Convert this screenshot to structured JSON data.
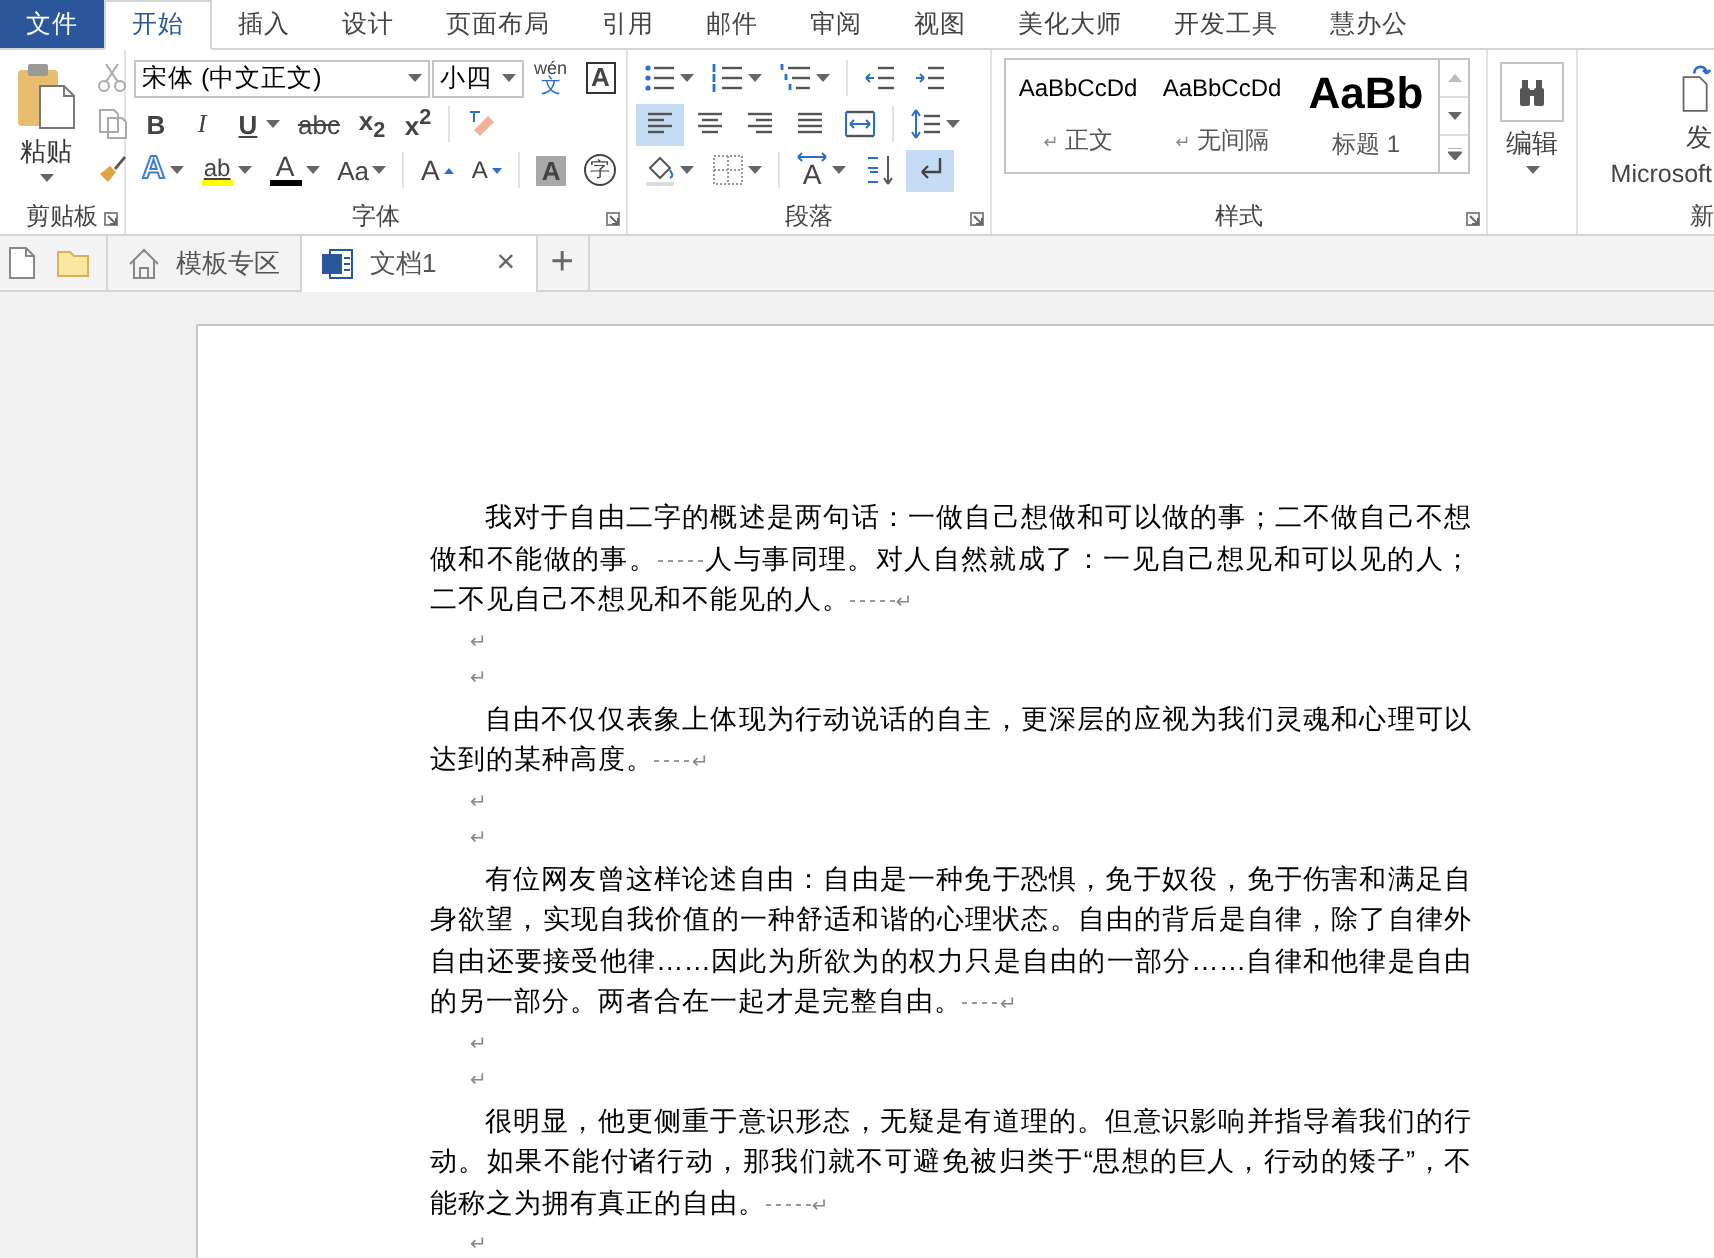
{
  "ribbon_tabs": [
    {
      "label": "文件",
      "kind": "file",
      "selected": false
    },
    {
      "label": "开始",
      "kind": "normal",
      "selected": true
    },
    {
      "label": "插入",
      "kind": "normal",
      "selected": false
    },
    {
      "label": "设计",
      "kind": "normal",
      "selected": false
    },
    {
      "label": "页面布局",
      "kind": "normal",
      "selected": false
    },
    {
      "label": "引用",
      "kind": "normal",
      "selected": false
    },
    {
      "label": "邮件",
      "kind": "normal",
      "selected": false
    },
    {
      "label": "审阅",
      "kind": "normal",
      "selected": false
    },
    {
      "label": "视图",
      "kind": "normal",
      "selected": false
    },
    {
      "label": "美化大师",
      "kind": "normal",
      "selected": false
    },
    {
      "label": "开发工具",
      "kind": "normal",
      "selected": false
    },
    {
      "label": "慧办公",
      "kind": "normal",
      "selected": false
    }
  ],
  "clipboard": {
    "paste": "粘贴",
    "label": "剪贴板"
  },
  "font": {
    "name": "宋体 (中文正文)",
    "size": "小四",
    "phonetic": "wén",
    "phonetic_char": "文",
    "border_char": "A",
    "format_buttons": [
      {
        "kind": "bold",
        "label": "B"
      },
      {
        "kind": "italic",
        "label": "I"
      },
      {
        "kind": "underline",
        "label": "U"
      },
      {
        "kind": "strike",
        "label": "abc"
      },
      {
        "kind": "sub",
        "label": "x$_{2}$"
      },
      {
        "kind": "sup",
        "label": "x$^{2}$"
      }
    ],
    "effects": "A",
    "highlight": "ab",
    "font_color_char": "A",
    "case": "Aa",
    "grow": "A",
    "shrink": "A",
    "shading": "A",
    "enclose": "字",
    "label": "字体"
  },
  "paragraph": {
    "label": "段落",
    "align_buttons": [
      {
        "kind": "left",
        "selected": true
      },
      {
        "kind": "center",
        "selected": false
      },
      {
        "kind": "right",
        "selected": false
      },
      {
        "kind": "justify",
        "selected": false
      },
      {
        "kind": "distributed",
        "selected": false
      }
    ],
    "char_scale": "A",
    "show_marks": {
      "selected": true
    }
  },
  "styles": {
    "label": "样式",
    "items": [
      {
        "sample": "AaBbCcDd",
        "name": "正文",
        "kind": "normal",
        "mark": "↵"
      },
      {
        "sample": "AaBbCcDd",
        "name": "无间隔",
        "kind": "normal",
        "mark": "↵"
      },
      {
        "sample": "AaBb",
        "name": "标题 1",
        "kind": "heading"
      }
    ]
  },
  "editing": {
    "label": "编辑"
  },
  "send": {
    "label": "发",
    "sub": "Microsoft",
    "group": "新"
  },
  "doc_tabs": [
    {
      "label": "模板专区",
      "kind": "home",
      "selected": false
    },
    {
      "label": "文档1",
      "kind": "word",
      "selected": true,
      "close": "×"
    }
  ],
  "new_tab": "+",
  "paragraphs": [
    {
      "text": "我对于自由二字的概述是两句话：一做自己想做和可以做的事；二不做自己不想做和不能做的事。      人与事同理。对人自然就成了：一见自己想见和可以见的人；二不见自己不想见和不能见的人。      ",
      "mark": "↵"
    },
    {
      "mark": "↵"
    },
    {
      "mark": "↵"
    },
    {
      "text": "自由不仅仅表象上体现为行动说话的自主，更深层的应视为我们灵魂和心理可以达到的某种高度。     ",
      "mark": "↵"
    },
    {
      "mark": "↵"
    },
    {
      "mark": "↵"
    },
    {
      "text": "有位网友曾这样论述自由：自由是一种免于恐惧，免于奴役，免于伤害和满足自身欲望，实现自我价值的一种舒适和谐的心理状态。自由的背后是自律，除了自律外自由还要接受他律……因此为所欲为的权力只是自由的一部分……自律和他律是自由的另一部分。两者合在一起才是完整自由。     ",
      "mark": "↵"
    },
    {
      "mark": "↵"
    },
    {
      "mark": "↵"
    },
    {
      "text": "很明显，他更侧重于意识形态，无疑是有道理的。但意识影响并指导着我们的行动。如果不能付诸行动，那我们就不可避免被归类于“思想的巨人，行动的矮子”，不能称之为拥有真正的自由。      ",
      "mark": "↵"
    },
    {
      "mark": "↵"
    }
  ]
}
